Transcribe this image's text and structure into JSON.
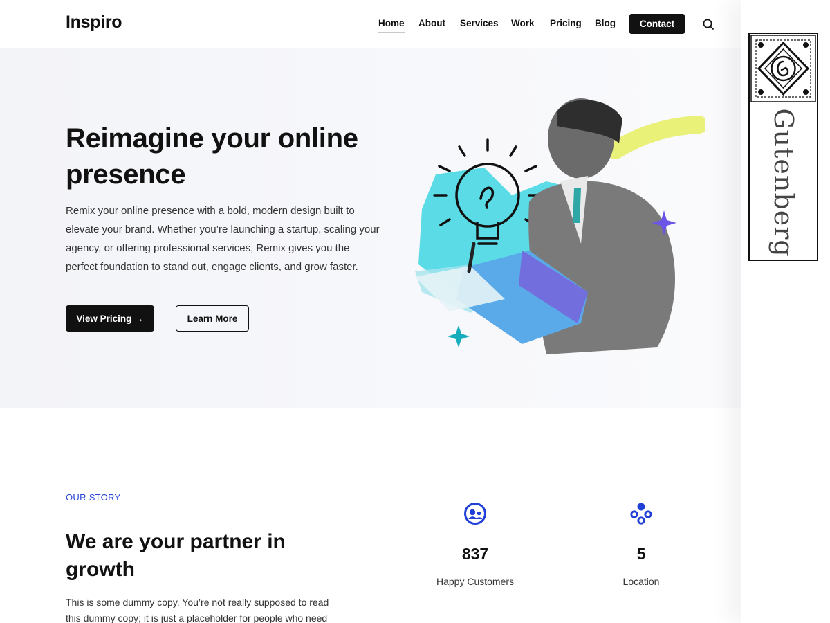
{
  "header": {
    "logo": "Inspiro",
    "nav": [
      {
        "label": "Home",
        "active": true
      },
      {
        "label": "About"
      },
      {
        "label": "Services"
      },
      {
        "label": "Work"
      },
      {
        "label": "Pricing"
      },
      {
        "label": "Blog"
      }
    ],
    "contact_label": "Contact",
    "search_icon": "search-icon"
  },
  "hero": {
    "title": "Reimagine your online presence",
    "description": "Remix your online presence with a bold, modern design built to elevate your brand. Whether you’re launching a startup, scaling your agency, or offering professional services, Remix gives you the perfect foundation to stand out, engage clients, and grow faster.",
    "primary_button": "View Pricing →",
    "secondary_button": "Learn More"
  },
  "story": {
    "eyebrow": "OUR STORY",
    "title": "We are your partner in growth",
    "text": "This is some dummy copy. You’re not really supposed to read this dummy copy; it is just a placeholder for people who need"
  },
  "stats": [
    {
      "number": "837",
      "label": "Happy Customers",
      "icon": "happy-customers-icon"
    },
    {
      "number": "5",
      "label": "Location",
      "icon": "location-icon"
    }
  ],
  "sidebar_badge": {
    "word": "Gutenberg"
  },
  "colors": {
    "accent": "#2b45d6",
    "dark": "#111111",
    "hero_bg": "#f4f5f9"
  }
}
